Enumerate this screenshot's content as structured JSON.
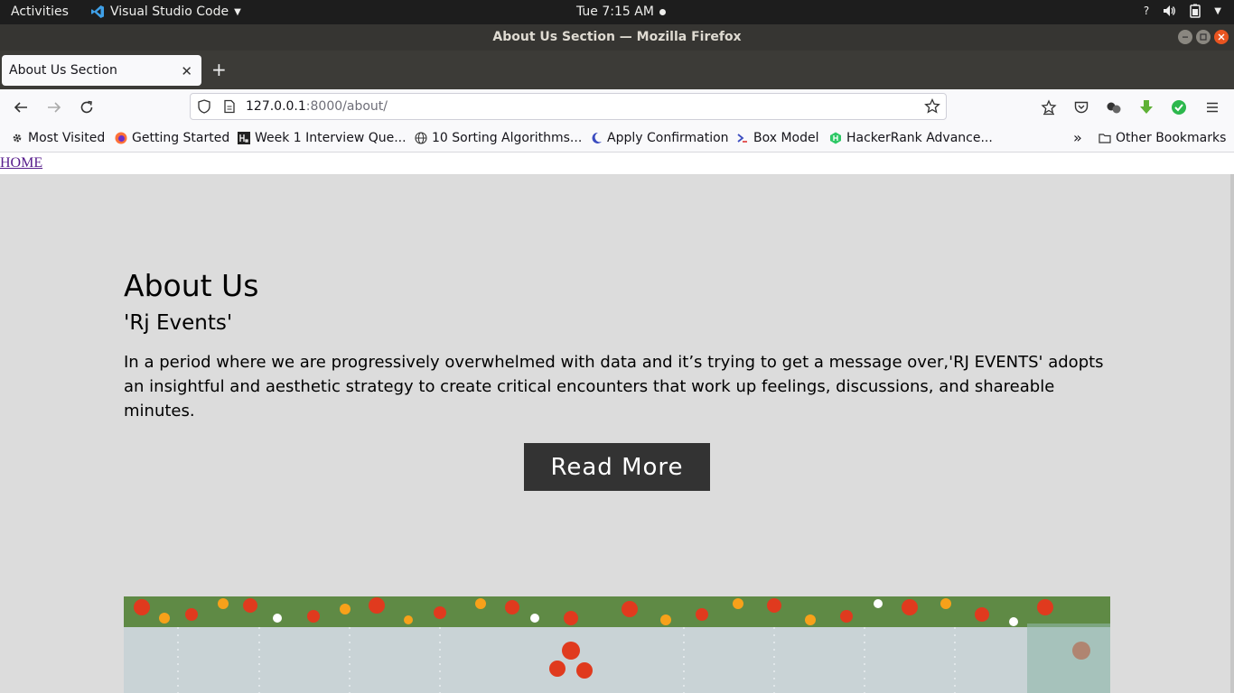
{
  "system_bar": {
    "activities": "Activities",
    "app_name": "Visual Studio Code",
    "clock": "Tue  7:15 AM"
  },
  "window": {
    "title": "About Us Section — Mozilla Firefox"
  },
  "tabs": [
    {
      "label": "About Us Section",
      "active": true
    }
  ],
  "urlbar": {
    "host": "127.0.0.1",
    "rest": ":8000/about/"
  },
  "bookmarks": [
    {
      "label": "Most Visited",
      "icon": "gear-icon"
    },
    {
      "label": "Getting Started",
      "icon": "firefox-icon"
    },
    {
      "label": "Week 1 Interview Que...",
      "icon": "hackerearth-icon"
    },
    {
      "label": "10 Sorting Algorithms...",
      "icon": "globe-icon"
    },
    {
      "label": "Apply Confirmation",
      "icon": "moon-icon"
    },
    {
      "label": "Box Model",
      "icon": "terminal-icon"
    },
    {
      "label": "HackerRank Advance...",
      "icon": "hackerrank-icon"
    }
  ],
  "other_bookmarks": "Other Bookmarks",
  "page": {
    "home_link": "HOME",
    "title": "About Us",
    "subtitle": "'Rj Events'",
    "body": "In a period where we are progressively overwhelmed with data and it’s trying to get a message over,'RJ EVENTS' adopts an insightful and aesthetic strategy to create critical encounters that work up feelings, discussions, and shareable minutes.",
    "button": "Read More"
  },
  "colors": {
    "page_bg": "#dcdcdc",
    "button_bg": "#333333",
    "link": "#551a8b"
  }
}
